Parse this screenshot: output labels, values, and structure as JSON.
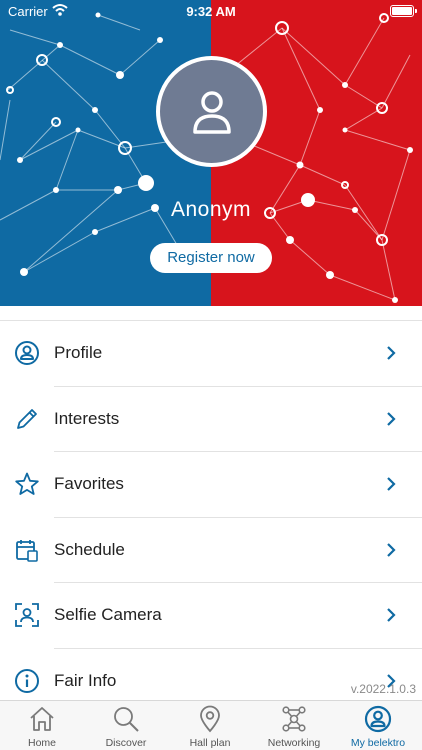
{
  "status_bar": {
    "carrier": "Carrier",
    "time": "9:32 AM"
  },
  "profile": {
    "name": "Anonym",
    "register_label": "Register now"
  },
  "menu": [
    {
      "label": "Profile",
      "icon": "user-circle-icon"
    },
    {
      "label": "Interests",
      "icon": "pencil-icon"
    },
    {
      "label": "Favorites",
      "icon": "star-icon"
    },
    {
      "label": "Schedule",
      "icon": "calendar-icon"
    },
    {
      "label": "Selfie Camera",
      "icon": "selfie-camera-icon"
    },
    {
      "label": "Fair Info",
      "icon": "info-icon"
    }
  ],
  "version": "v.2022.1.0.3",
  "tabs": [
    {
      "label": "Home",
      "icon": "home-icon"
    },
    {
      "label": "Discover",
      "icon": "search-icon"
    },
    {
      "label": "Hall plan",
      "icon": "map-pin-icon"
    },
    {
      "label": "Networking",
      "icon": "network-icon"
    },
    {
      "label": "My belektro",
      "icon": "user-circle-icon",
      "active": true
    }
  ],
  "colors": {
    "blue": "#0f6aa3",
    "red": "#d7141c",
    "avatar": "#6f7b93"
  }
}
